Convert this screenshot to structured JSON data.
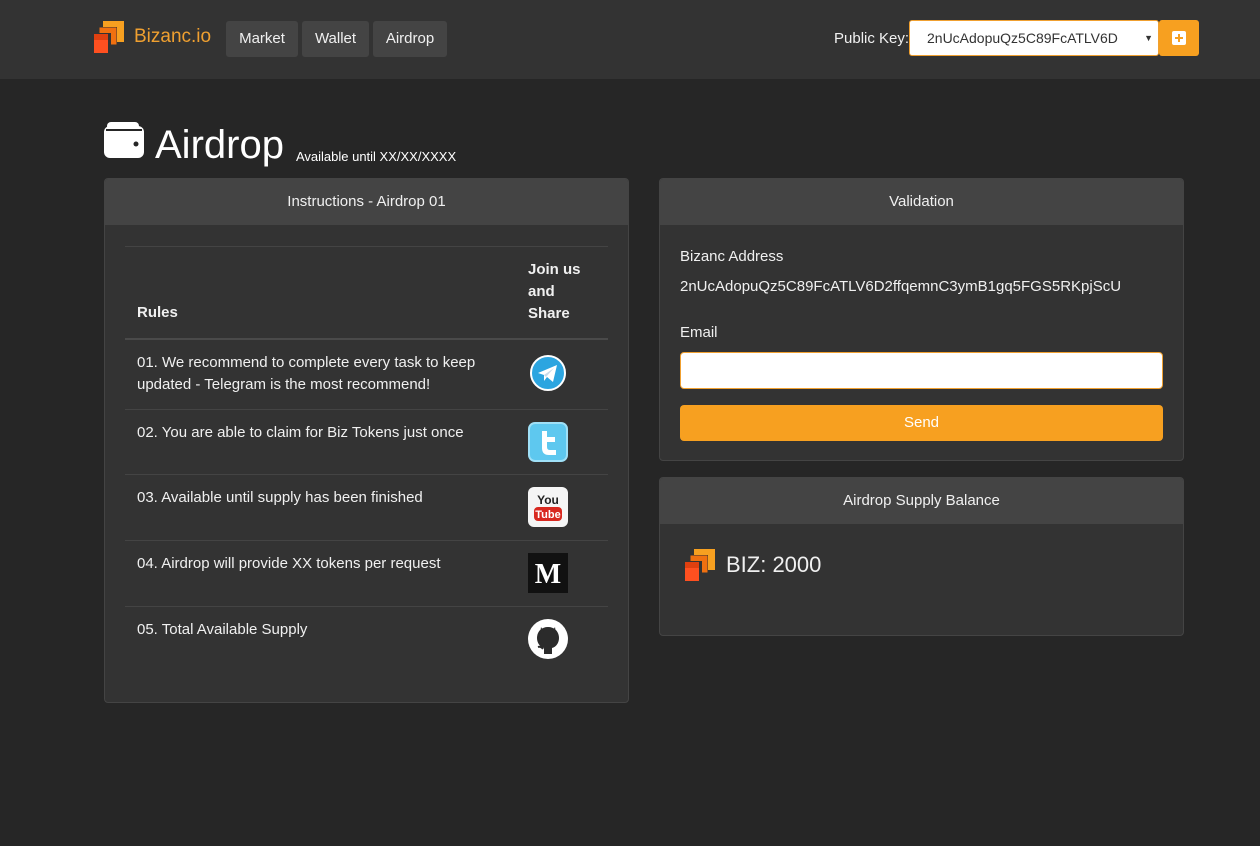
{
  "navbar": {
    "brand": "Bizanc.io",
    "links": [
      {
        "label": "Market"
      },
      {
        "label": "Wallet"
      },
      {
        "label": "Airdrop"
      }
    ],
    "public_key_label": "Public Key:",
    "public_key_value": "2nUcAdopuQz5C89FcATLV6D"
  },
  "page": {
    "title": "Airdrop",
    "subtitle": "Available until XX/XX/XXXX"
  },
  "instructions": {
    "heading": "Instructions - Airdrop 01",
    "col_rules": "Rules",
    "col_join": "Join us and Share",
    "rows": [
      {
        "text": "01. We recommend to complete every task to keep updated - Telegram is the most recommend!",
        "icon": "telegram-icon"
      },
      {
        "text": "02. You are able to claim for Biz Tokens just once",
        "icon": "twitter-icon"
      },
      {
        "text": "03. Available until supply has been finished",
        "icon": "youtube-icon"
      },
      {
        "text": "04. Airdrop will provide XX tokens per request",
        "icon": "medium-icon"
      },
      {
        "text": "05. Total Available Supply",
        "icon": "github-icon"
      }
    ]
  },
  "validation": {
    "heading": "Validation",
    "address_label": "Bizanc Address",
    "address_value": "2nUcAdopuQz5C89FcATLV6D2ffqemnC3ymB1gq5FGS5RKpjScU",
    "email_label": "Email",
    "email_value": "",
    "send_label": "Send"
  },
  "supply": {
    "heading": "Airdrop Supply Balance",
    "balance": "BIZ: 2000"
  },
  "colors": {
    "accent": "#f7a020",
    "background": "#262626",
    "panel": "#333333",
    "panel_header": "#444444"
  }
}
